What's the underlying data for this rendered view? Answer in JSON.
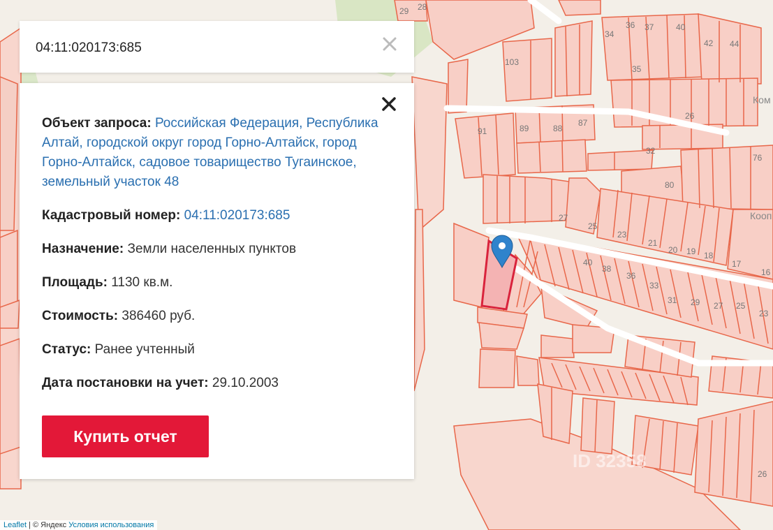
{
  "search": {
    "value": "04:11:020173:685"
  },
  "popup": {
    "object_label": "Объект запроса:",
    "object_value": "Российская Федерация, Республика Алтай, городской округ город Горно-Алтайск, город Горно-Алтайск, садовое товарищество Тугаинское, земельный участок 48",
    "cadastral_label": "Кадастровый номер:",
    "cadastral_value": "04:11:020173:685",
    "purpose_label": "Назначение:",
    "purpose_value": "Земли населенных пунктов",
    "area_label": "Площадь:",
    "area_value": "1130 кв.м.",
    "cost_label": "Стоимость:",
    "cost_value": "386460 руб.",
    "status_label": "Статус:",
    "status_value": "Ранее учтенный",
    "date_label": "Дата постановки на учет:",
    "date_value": "29.10.2003",
    "buy_button": "Купить отчет"
  },
  "map": {
    "parcel_numbers": [
      "29",
      "28",
      "34",
      "36",
      "37",
      "40",
      "42",
      "44",
      "35",
      "103",
      "91",
      "89",
      "88",
      "87",
      "32",
      "80",
      "76",
      "27",
      "25",
      "23",
      "21",
      "20",
      "19",
      "18",
      "17",
      "16",
      "40",
      "38",
      "36",
      "33",
      "31",
      "29",
      "27",
      "25",
      "23",
      "26",
      "26"
    ],
    "street_labels": [
      "Ком",
      "Кооп"
    ],
    "watermark": "ID 32358",
    "attribution": {
      "leaflet": "Leaflet",
      "separator": " | © Яндекс ",
      "terms": "Условия использования"
    }
  },
  "colors": {
    "parcel_fill": "#f8cfc6",
    "parcel_stroke": "#e8674a",
    "selected_fill": "#f4b3b3",
    "selected_stroke": "#d9233c",
    "marker": "#2f83cc",
    "button": "#e31838",
    "link": "#2a6fb0"
  }
}
